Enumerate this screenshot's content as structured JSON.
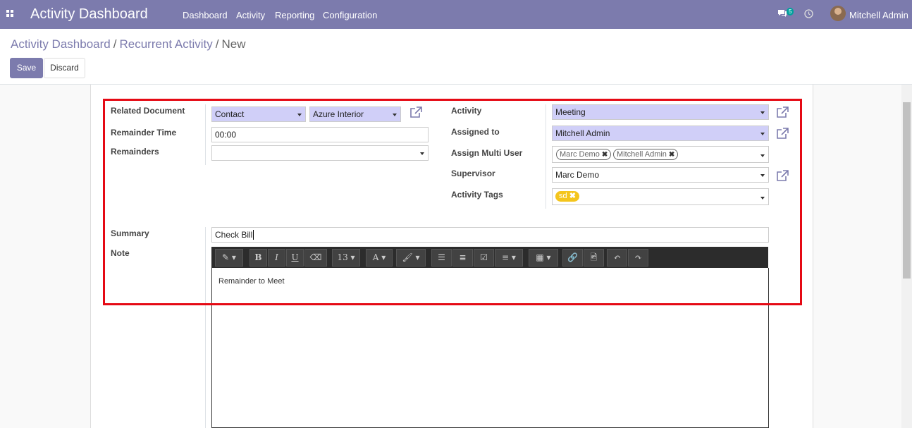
{
  "navbar": {
    "brand": "Activity Dashboard",
    "menu": [
      "Dashboard",
      "Activity",
      "Reporting",
      "Configuration"
    ],
    "chat_count": "5",
    "user": "Mitchell Admin",
    "icons": [
      "apps-icon",
      "chat-icon",
      "clock-icon"
    ]
  },
  "breadcrumb": {
    "root": "Activity Dashboard",
    "middle": "Recurrent Activity",
    "current": "New",
    "separator": "/"
  },
  "buttons": {
    "save": "Save",
    "discard": "Discard"
  },
  "form": {
    "labels": {
      "related_document": "Related Document",
      "remainder_time": "Remainder Time",
      "remainders": "Remainders",
      "activity": "Activity",
      "assigned_to": "Assigned to",
      "assign_multi_user": "Assign Multi User",
      "supervisor": "Supervisor",
      "activity_tags": "Activity Tags",
      "summary": "Summary",
      "note": "Note"
    },
    "values": {
      "related_model": "Contact",
      "related_record": "Azure Interior",
      "remainder_time": "00:00",
      "remainders": "",
      "activity": "Meeting",
      "assigned_to": "Mitchell Admin",
      "multi_users": [
        "Marc Demo",
        "Mitchell Admin"
      ],
      "supervisor": "Marc Demo",
      "tags": [
        "sd"
      ],
      "summary": "Check Bill",
      "note": "Remainder to Meet"
    },
    "toolbar": {
      "font_size": "13"
    }
  },
  "colors": {
    "brand": "#7c7bad",
    "selected_field": "#d0cff8",
    "tag": "#f4c51d",
    "highlight": "#e50914"
  }
}
